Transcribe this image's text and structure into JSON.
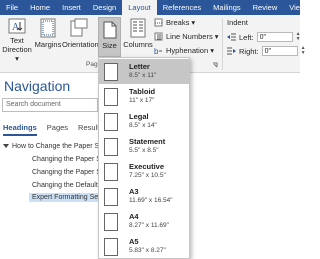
{
  "ribbon_tabs": [
    {
      "label": "File",
      "active": false
    },
    {
      "label": "Home",
      "active": false
    },
    {
      "label": "Insert",
      "active": false
    },
    {
      "label": "Design",
      "active": false
    },
    {
      "label": "Layout",
      "active": true
    },
    {
      "label": "References",
      "active": false
    },
    {
      "label": "Mailings",
      "active": false
    },
    {
      "label": "Review",
      "active": false
    },
    {
      "label": "View",
      "active": false
    }
  ],
  "ribbon": {
    "text_direction_line1": "Text",
    "text_direction_line2": "Direction ▾",
    "margins": "Margins",
    "orientation": "Orientation",
    "size": "Size",
    "columns": "Columns",
    "breaks": "Breaks ▾",
    "line_numbers": "Line Numbers ▾",
    "hyphenation": "Hyphenation ▾",
    "indent_header": "Indent",
    "indent_left_label": "Left:",
    "indent_left_value": "0\"",
    "indent_right_label": "Right:",
    "indent_right_value": "0\"",
    "page_setup_group": "Pag"
  },
  "navigation": {
    "title": "Navigation",
    "search_placeholder": "Search document",
    "tabs": [
      "Headings",
      "Pages",
      "Result"
    ],
    "tree": [
      {
        "label": "How to Change the Paper Si",
        "level": 0,
        "selected": false
      },
      {
        "label": "Changing the Paper Si",
        "level": 1,
        "selected": false
      },
      {
        "label": "Changing the Paper Si",
        "level": 1,
        "selected": false
      },
      {
        "label": "Changing the Default",
        "level": 1,
        "selected": false
      },
      {
        "label": "Expert Formatting Ser",
        "level": 1,
        "selected": true
      }
    ]
  },
  "size_dropdown": [
    {
      "name": "Letter",
      "dims": "8.5\" x 11\"",
      "selected": true
    },
    {
      "name": "Tabloid",
      "dims": "11\" x 17\"",
      "selected": false
    },
    {
      "name": "Legal",
      "dims": "8.5\" x 14\"",
      "selected": false
    },
    {
      "name": "Statement",
      "dims": "5.5\" x 8.5\"",
      "selected": false
    },
    {
      "name": "Executive",
      "dims": "7.25\" x 10.5\"",
      "selected": false
    },
    {
      "name": "A3",
      "dims": "11.69\" x 16.54\"",
      "selected": false
    },
    {
      "name": "A4",
      "dims": "8.27\" x 11.69\"",
      "selected": false
    },
    {
      "name": "A5",
      "dims": "5.83\" x 8.27\"",
      "selected": false
    }
  ]
}
